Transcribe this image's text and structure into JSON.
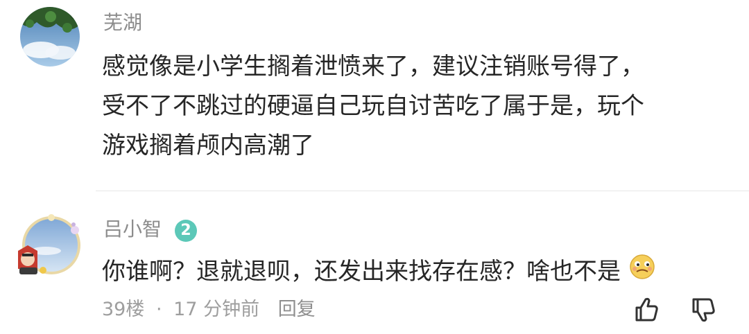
{
  "comments": [
    {
      "username": "芜湖",
      "lines": [
        "感觉像是小学生搁着泄愤来了，建议注销账号得了，",
        "受不了不跳过的硬逼自己玩自讨苦吃了属于是，玩个",
        "游戏搁着颅内高潮了"
      ]
    },
    {
      "username": "吕小智",
      "level": "2",
      "text": "你谁啊？退就退呗，还发出来找存在感？啥也不是",
      "floor": "39楼",
      "separator": "·",
      "time": "17 分钟前",
      "reply_label": "回复",
      "actions": [
        "thumbs-up-icon",
        "thumbs-down-icon"
      ]
    }
  ],
  "colors": {
    "username": "#8c8c8c",
    "text": "#262626",
    "meta": "#9e9e9e",
    "level_badge": "#5cc8b8",
    "divider": "#e6e6e6"
  }
}
